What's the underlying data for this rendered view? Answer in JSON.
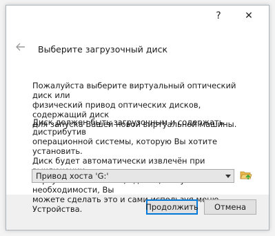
{
  "titlebar": {
    "help_label": "?",
    "close_label": "✕"
  },
  "wizard": {
    "title": "Выберите загрузочный диск",
    "paragraph1": "Пожалуйста выберите виртуальный оптический диск или\nфизический привод оптических дисков, содержащий диск\nдля запуска Вашей новой виртуальной машины.",
    "paragraph2": "Диск должен быть загрузочным и содержать дистрибутив\nоперационной системы, которую Вы хотите установить.\nДиск будет автоматически извлечён при выключении\nвиртуальной машины, однако, в случае необходимости, Вы\nможете сделать это и сами используя меню Устройства."
  },
  "combo": {
    "selected": "Привод хоста 'G:'"
  },
  "buttons": {
    "continue_label": "Продолжить",
    "cancel_label": "Отмена"
  },
  "colors": {
    "accent": "#0078d7",
    "folder": "#e8b84a",
    "folder_arrow": "#3aa43a"
  },
  "icons": {
    "back": "arrow-left-icon",
    "combo_arrow": "chevron-down-icon",
    "folder": "folder-open-icon"
  }
}
